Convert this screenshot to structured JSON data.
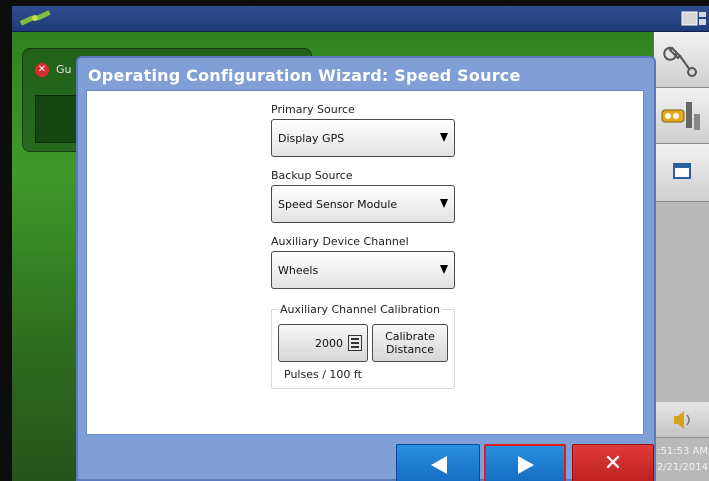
{
  "background": {
    "card_title": "Gu"
  },
  "dialog": {
    "title": "Operating Configuration Wizard:  Speed Source"
  },
  "fields": {
    "primary": {
      "label": "Primary Source",
      "value": "Display GPS"
    },
    "backup": {
      "label": "Backup Source",
      "value": "Speed Sensor Module"
    },
    "aux": {
      "label": "Auxiliary Device Channel",
      "value": "Wheels"
    }
  },
  "calibration": {
    "group_label": "Auxiliary Channel Calibration",
    "pulses_value": "2000",
    "calibrate_label": "Calibrate Distance",
    "unit_label": "Pulses / 100 ft"
  },
  "status": {
    "time": ":51:53 AM",
    "date": "2/21/2014"
  },
  "icons": {
    "satellite": "satellite-icon",
    "view_toggle": "view-toggle-icon",
    "wrench": "wrench-icon",
    "tools": "tools-icon",
    "window": "window-icon",
    "volume": "volume-icon",
    "keypad": "keypad-icon",
    "back": "back-arrow-icon",
    "next": "next-arrow-icon",
    "cancel": "close-icon"
  },
  "colors": {
    "title_bar": "#1f3a78",
    "dialog": "#7f9fd6",
    "nav_blue": "#146dc4",
    "cancel_red": "#bf1f1f",
    "highlight": "#e21c1c"
  }
}
